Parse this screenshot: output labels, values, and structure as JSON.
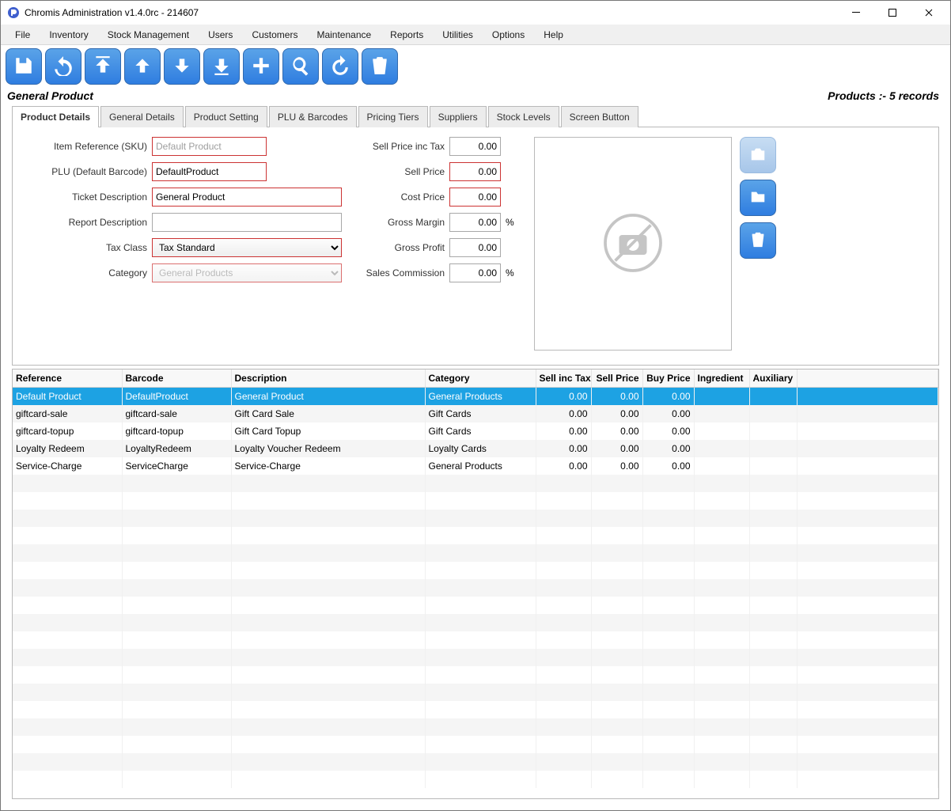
{
  "window": {
    "title": "Chromis Administration v1.4.0rc - 214607"
  },
  "menu": {
    "items": [
      "File",
      "Inventory",
      "Stock Management",
      "Users",
      "Customers",
      "Maintenance",
      "Reports",
      "Utilities",
      "Options",
      "Help"
    ]
  },
  "subheader": {
    "title": "General Product",
    "records": "Products :- 5 records"
  },
  "tabs": [
    "Product Details",
    "General Details",
    "Product Setting",
    "PLU & Barcodes",
    "Pricing Tiers",
    "Suppliers",
    "Stock Levels",
    "Screen Button"
  ],
  "form": {
    "labels": {
      "sku": "Item Reference (SKU)",
      "plu": "PLU (Default Barcode)",
      "ticket": "Ticket Description",
      "report": "Report Description",
      "taxclass": "Tax Class",
      "category": "Category",
      "sellinc": "Sell Price inc Tax",
      "sell": "Sell Price",
      "cost": "Cost Price",
      "margin": "Gross Margin",
      "profit": "Gross Profit",
      "commission": "Sales Commission"
    },
    "values": {
      "sku": "Default Product",
      "plu": "DefaultProduct",
      "ticket": "General Product",
      "report": "",
      "taxclass": "Tax Standard",
      "category": "General Products",
      "sellinc": "0.00",
      "sell": "0.00",
      "cost": "0.00",
      "margin": "0.00",
      "profit": "0.00",
      "commission": "0.00",
      "pct": "%"
    }
  },
  "grid": {
    "headers": [
      "Reference",
      "Barcode",
      "Description",
      "Category",
      "Sell inc Tax",
      "Sell Price",
      "Buy Price",
      "Ingredient",
      "Auxiliary"
    ],
    "rows": [
      {
        "ref": "Default Product",
        "barcode": "DefaultProduct",
        "desc": "General Product",
        "cat": "General Products",
        "sellinc": "0.00",
        "sell": "0.00",
        "buy": "0.00",
        "ing": "",
        "aux": "",
        "selected": true
      },
      {
        "ref": "giftcard-sale",
        "barcode": "giftcard-sale",
        "desc": "Gift Card Sale",
        "cat": "Gift Cards",
        "sellinc": "0.00",
        "sell": "0.00",
        "buy": "0.00",
        "ing": "",
        "aux": ""
      },
      {
        "ref": "giftcard-topup",
        "barcode": "giftcard-topup",
        "desc": "Gift Card Topup",
        "cat": "Gift Cards",
        "sellinc": "0.00",
        "sell": "0.00",
        "buy": "0.00",
        "ing": "",
        "aux": ""
      },
      {
        "ref": "Loyalty Redeem",
        "barcode": "LoyaltyRedeem",
        "desc": "Loyalty Voucher Redeem",
        "cat": "Loyalty Cards",
        "sellinc": "0.00",
        "sell": "0.00",
        "buy": "0.00",
        "ing": "",
        "aux": ""
      },
      {
        "ref": "Service-Charge",
        "barcode": "ServiceCharge",
        "desc": "Service-Charge",
        "cat": "General Products",
        "sellinc": "0.00",
        "sell": "0.00",
        "buy": "0.00",
        "ing": "",
        "aux": ""
      }
    ]
  }
}
